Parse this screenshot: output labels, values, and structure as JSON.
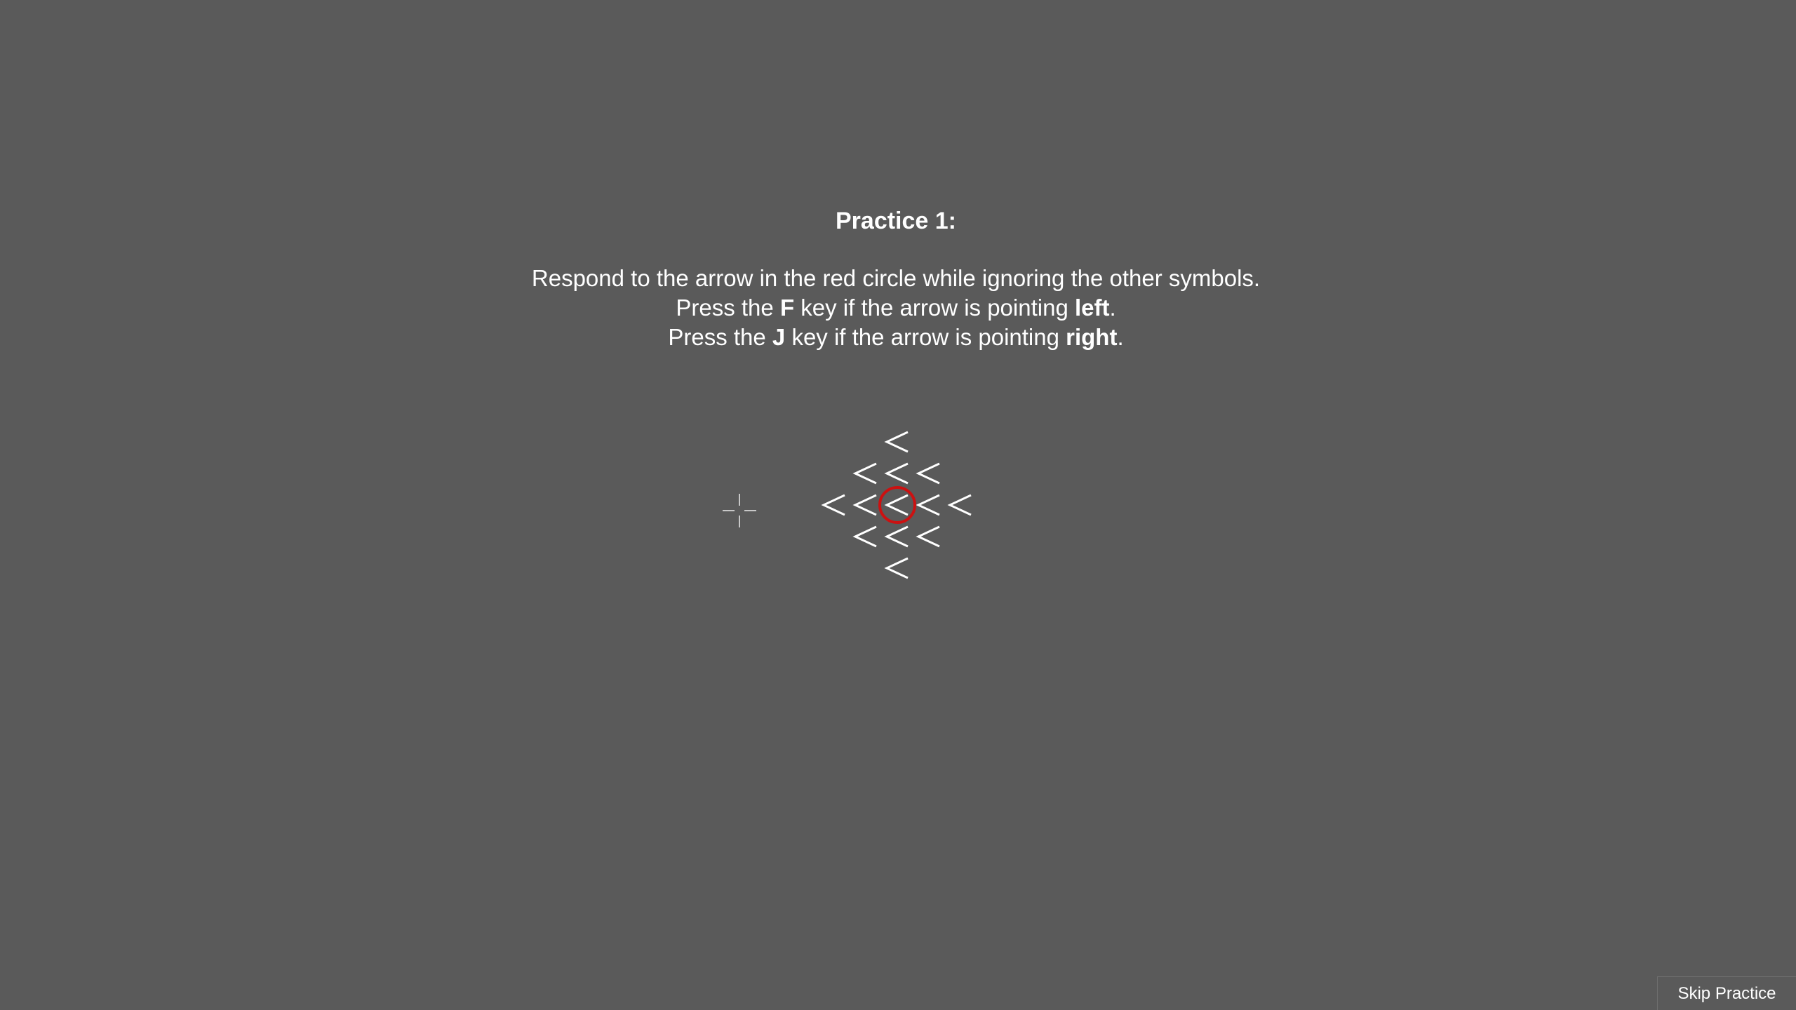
{
  "instructions": {
    "title": "Practice 1:",
    "line1": "Respond to the arrow in the red circle while ignoring the other symbols.",
    "line2_a": "Press the ",
    "line2_key": "F",
    "line2_b": " key if the arrow is pointing ",
    "line2_dir": "left",
    "line2_end": ".",
    "line3_a": "Press the ",
    "line3_key": "J",
    "line3_b": " key if the arrow is pointing ",
    "line3_dir": "right",
    "line3_end": "."
  },
  "stimulus": {
    "arrow_glyph": "<",
    "rows": [
      1,
      3,
      5,
      3,
      1
    ],
    "target_highlight": "red-circle",
    "target_color": "#cc1111",
    "arrow_color": "#ffffff"
  },
  "fixation": {
    "icon": "fixation-cross-icon",
    "color": "#c8c8c8"
  },
  "controls": {
    "skip_label": "Skip Practice"
  },
  "colors": {
    "background": "#5a5a5a",
    "text": "#ffffff"
  }
}
